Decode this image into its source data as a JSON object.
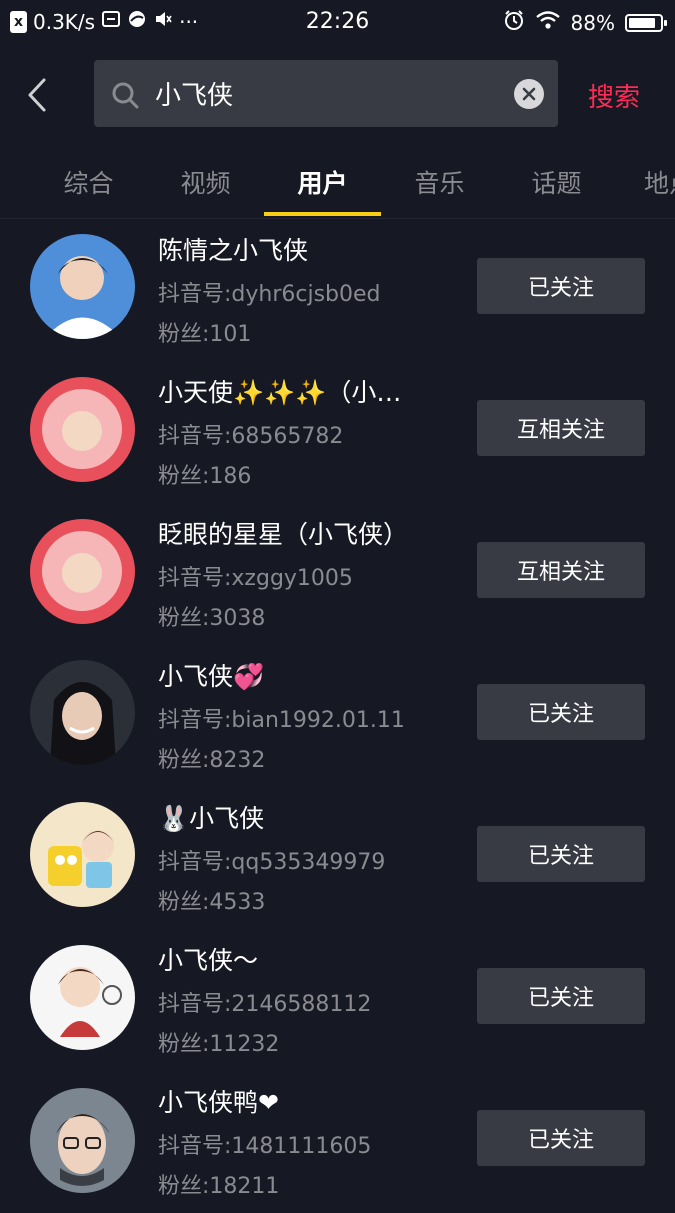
{
  "status_bar": {
    "net_badge": "x",
    "net_speed": "0.3K/s",
    "more": "···",
    "time": "22:26",
    "battery": "88%",
    "battery_level": 0.88
  },
  "search": {
    "query": "小飞侠",
    "button_label": "搜索"
  },
  "tabs": [
    {
      "label": "综合",
      "active": false
    },
    {
      "label": "视频",
      "active": false
    },
    {
      "label": "用户",
      "active": true
    },
    {
      "label": "音乐",
      "active": false
    },
    {
      "label": "话题",
      "active": false
    },
    {
      "label": "地点",
      "active": false
    }
  ],
  "users": [
    {
      "name": "陈情之小飞侠",
      "douyin_id": "抖音号:dyhr6cjsb0ed",
      "fans": "粉丝:101",
      "follow_label": "已关注",
      "avatar_color": "#3f78c8"
    },
    {
      "name": "小天使✨✨✨（小…",
      "douyin_id": "抖音号:68565782",
      "fans": "粉丝:186",
      "follow_label": "互相关注",
      "avatar_color": "#e8505b"
    },
    {
      "name": "眨眼的星星（小飞侠）",
      "douyin_id": "抖音号:xzggy1005",
      "fans": "粉丝:3038",
      "follow_label": "互相关注",
      "avatar_color": "#e8505b"
    },
    {
      "name": "小飞侠💞",
      "douyin_id": "抖音号:bian1992.01.11",
      "fans": "粉丝:8232",
      "follow_label": "已关注",
      "avatar_color": "#2a2f38"
    },
    {
      "name": "🐰小飞侠",
      "douyin_id": "抖音号:qq535349979",
      "fans": "粉丝:4533",
      "follow_label": "已关注",
      "avatar_color": "#f4e6c8"
    },
    {
      "name": "小飞侠～",
      "douyin_id": "抖音号:2146588112",
      "fans": "粉丝:11232",
      "follow_label": "已关注",
      "avatar_color": "#f6f6f6"
    },
    {
      "name": "小飞侠鸭❤",
      "douyin_id": "抖音号:1481111605",
      "fans": "粉丝:18211",
      "follow_label": "已关注",
      "avatar_color": "#7c8690"
    }
  ],
  "colors": {
    "background": "#161823",
    "accent": "#fe2c55",
    "tab_indicator": "#face15",
    "button_bg": "#393b44",
    "secondary_text": "#8a8b91"
  }
}
